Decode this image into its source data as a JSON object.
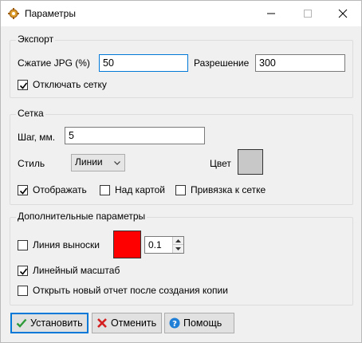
{
  "window": {
    "title": "Параметры"
  },
  "export": {
    "title": "Экспорт",
    "jpg_label": "Сжатие JPG (%)",
    "jpg_value": "50",
    "resolution_label": "Разрешение",
    "resolution_value": "300",
    "disable_grid_label": "Отключать сетку",
    "disable_grid_checked": true
  },
  "grid": {
    "title": "Сетка",
    "step_label": "Шаг, мм.",
    "step_value": "5",
    "style_label": "Стиль",
    "style_value": "Линии",
    "color_label": "Цвет",
    "color_value": "#c8c8c8",
    "show_label": "Отображать",
    "show_checked": true,
    "above_map_label": "Над картой",
    "above_map_checked": false,
    "snap_label": "Привязка к сетке",
    "snap_checked": false
  },
  "extra": {
    "title": "Дополнительные параметры",
    "leader_label": "Линия выноски",
    "leader_checked": false,
    "leader_color": "#ff0000",
    "leader_width": "0.1",
    "scale_label": "Линейный масштаб",
    "scale_checked": true,
    "open_report_label": "Открыть новый отчет после создания копии",
    "open_report_checked": false
  },
  "buttons": {
    "ok_label": "Установить",
    "cancel_label": "Отменить",
    "help_label": "Помощь"
  },
  "icons": {
    "app": "gear-icon",
    "ok": "checkmark-icon",
    "cancel": "x-icon",
    "help": "help-icon"
  },
  "colors": {
    "accent": "#0078d7",
    "ok_green": "#2e9a3a",
    "cancel_red": "#d42020",
    "help_blue": "#1f7ed6"
  }
}
